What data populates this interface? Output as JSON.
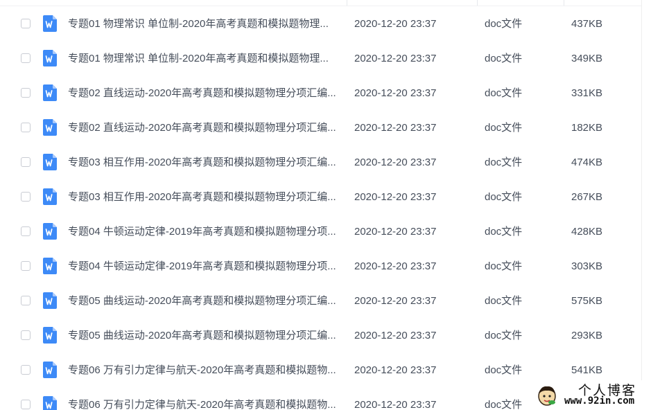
{
  "file_list": {
    "rows": [
      {
        "name": "专题01 物理常识 单位制-2020年高考真题和模拟题物理...",
        "date": "2020-12-20 23:37",
        "type": "doc文件",
        "size": "437KB"
      },
      {
        "name": "专题01 物理常识 单位制-2020年高考真题和模拟题物理...",
        "date": "2020-12-20 23:37",
        "type": "doc文件",
        "size": "349KB"
      },
      {
        "name": "专题02 直线运动-2020年高考真题和模拟题物理分项汇编...",
        "date": "2020-12-20 23:37",
        "type": "doc文件",
        "size": "331KB"
      },
      {
        "name": "专题02 直线运动-2020年高考真题和模拟题物理分项汇编...",
        "date": "2020-12-20 23:37",
        "type": "doc文件",
        "size": "182KB"
      },
      {
        "name": "专题03 相互作用-2020年高考真题和模拟题物理分项汇编...",
        "date": "2020-12-20 23:37",
        "type": "doc文件",
        "size": "474KB"
      },
      {
        "name": "专题03 相互作用-2020年高考真题和模拟题物理分项汇编...",
        "date": "2020-12-20 23:37",
        "type": "doc文件",
        "size": "267KB"
      },
      {
        "name": "专题04 牛顿运动定律-2019年高考真题和模拟题物理分项...",
        "date": "2020-12-20 23:37",
        "type": "doc文件",
        "size": "428KB"
      },
      {
        "name": "专题04 牛顿运动定律-2019年高考真题和模拟题物理分项...",
        "date": "2020-12-20 23:37",
        "type": "doc文件",
        "size": "303KB"
      },
      {
        "name": "专题05 曲线运动-2020年高考真题和模拟题物理分项汇编...",
        "date": "2020-12-20 23:37",
        "type": "doc文件",
        "size": "575KB"
      },
      {
        "name": "专题05 曲线运动-2020年高考真题和模拟题物理分项汇编...",
        "date": "2020-12-20 23:37",
        "type": "doc文件",
        "size": "293KB"
      },
      {
        "name": "专题06 万有引力定律与航天-2020年高考真题和模拟题物...",
        "date": "2020-12-20 23:37",
        "type": "doc文件",
        "size": "541KB"
      },
      {
        "name": "专题06 万有引力定律与航天-2020年高考真题和模拟题物...",
        "date": "2020-12-20 23:37",
        "type": "doc文件",
        "size": ""
      }
    ]
  },
  "watermark": {
    "title": "个人博客",
    "url": "www.92in.com"
  },
  "colors": {
    "doc_icon": "#3d8af7",
    "text": "#454d5a",
    "checkbox_border": "#c9ccd3"
  },
  "icons": {
    "file": "word-doc-icon",
    "row_select": "checkbox-icon"
  }
}
